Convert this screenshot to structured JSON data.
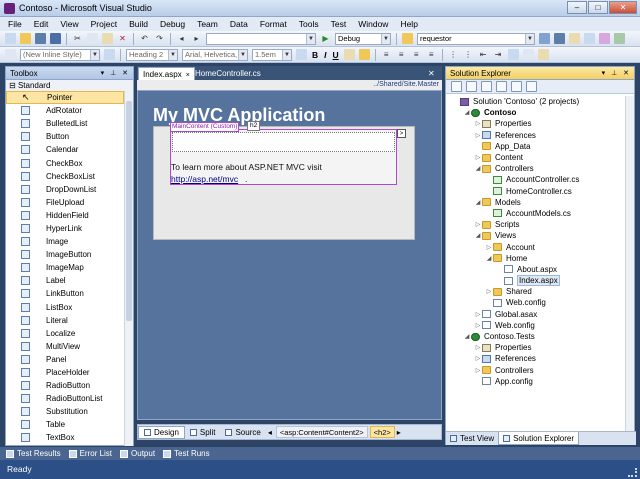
{
  "window": {
    "title": "Contoso - Microsoft Visual Studio",
    "minimize": "–",
    "maximize": "□",
    "close": "✕"
  },
  "menu": [
    "File",
    "Edit",
    "View",
    "Project",
    "Build",
    "Debug",
    "Team",
    "Data",
    "Format",
    "Tools",
    "Test",
    "Window",
    "Help"
  ],
  "toolbar1": {
    "config": "Debug",
    "find_value": "requestor"
  },
  "toolbar2": {
    "style": "(New Inline Style)",
    "block_format": "Heading 2",
    "font": "Arial, Helvetica, s",
    "size": "1.5em",
    "bold": "B",
    "italic": "I",
    "underline": "U"
  },
  "toolbox": {
    "title": "Toolbox",
    "group": "Standard",
    "items": [
      "Pointer",
      "AdRotator",
      "BulletedList",
      "Button",
      "Calendar",
      "CheckBox",
      "CheckBoxList",
      "DropDownList",
      "FileUpload",
      "HiddenField",
      "HyperLink",
      "Image",
      "ImageButton",
      "ImageMap",
      "Label",
      "LinkButton",
      "ListBox",
      "Literal",
      "Localize",
      "MultiView",
      "Panel",
      "PlaceHolder",
      "RadioButton",
      "RadioButtonList",
      "Substitution",
      "Table",
      "TextBox"
    ]
  },
  "editor": {
    "tabs": [
      {
        "label": "Index.aspx",
        "close": "×"
      },
      {
        "label": "HomeController.cs",
        "close": ""
      }
    ],
    "master_path": "../Shared/Site.Master",
    "app_title": "My MVC Application",
    "content_label": "MainContent (Custom)",
    "h2_badge": "h2",
    "smart_tag": ">",
    "body_text": "To learn more about ASP.NET MVC visit",
    "link_text": "http://asp.net/mvc",
    "link_suffix": ".",
    "views": [
      "Design",
      "Split",
      "Source"
    ],
    "breadcrumbs": [
      "<asp:Content#Content2>",
      "<h2>"
    ]
  },
  "solution_explorer": {
    "title": "Solution Explorer",
    "tree": [
      {
        "label": "Solution 'Contoso' (2 projects)",
        "level": 0,
        "icon": "sol",
        "twisty": ""
      },
      {
        "label": "Contoso",
        "level": 1,
        "icon": "proj",
        "twisty": "◢",
        "bold": true
      },
      {
        "label": "Properties",
        "level": 2,
        "icon": "prop",
        "twisty": "▷"
      },
      {
        "label": "References",
        "level": 2,
        "icon": "ref",
        "twisty": "▷"
      },
      {
        "label": "App_Data",
        "level": 2,
        "icon": "folder",
        "twisty": ""
      },
      {
        "label": "Content",
        "level": 2,
        "icon": "folder",
        "twisty": "▷"
      },
      {
        "label": "Controllers",
        "level": 2,
        "icon": "folder",
        "twisty": "◢"
      },
      {
        "label": "AccountController.cs",
        "level": 3,
        "icon": "cs",
        "twisty": ""
      },
      {
        "label": "HomeController.cs",
        "level": 3,
        "icon": "cs",
        "twisty": ""
      },
      {
        "label": "Models",
        "level": 2,
        "icon": "folder",
        "twisty": "◢"
      },
      {
        "label": "AccountModels.cs",
        "level": 3,
        "icon": "cs",
        "twisty": ""
      },
      {
        "label": "Scripts",
        "level": 2,
        "icon": "folder",
        "twisty": "▷"
      },
      {
        "label": "Views",
        "level": 2,
        "icon": "folder",
        "twisty": "◢"
      },
      {
        "label": "Account",
        "level": 3,
        "icon": "folder",
        "twisty": "▷"
      },
      {
        "label": "Home",
        "level": 3,
        "icon": "folder",
        "twisty": "◢"
      },
      {
        "label": "About.aspx",
        "level": 4,
        "icon": "file",
        "twisty": ""
      },
      {
        "label": "Index.aspx",
        "level": 4,
        "icon": "file",
        "twisty": "",
        "selected": true
      },
      {
        "label": "Shared",
        "level": 3,
        "icon": "folder",
        "twisty": "▷"
      },
      {
        "label": "Web.config",
        "level": 3,
        "icon": "file",
        "twisty": ""
      },
      {
        "label": "Global.asax",
        "level": 2,
        "icon": "file",
        "twisty": "▷"
      },
      {
        "label": "Web.config",
        "level": 2,
        "icon": "file",
        "twisty": "▷"
      },
      {
        "label": "Contoso.Tests",
        "level": 1,
        "icon": "proj",
        "twisty": "◢"
      },
      {
        "label": "Properties",
        "level": 2,
        "icon": "prop",
        "twisty": "▷"
      },
      {
        "label": "References",
        "level": 2,
        "icon": "ref",
        "twisty": "▷"
      },
      {
        "label": "Controllers",
        "level": 2,
        "icon": "folder",
        "twisty": "▷"
      },
      {
        "label": "App.config",
        "level": 2,
        "icon": "file",
        "twisty": ""
      }
    ],
    "tabs": [
      "Test View",
      "Solution Explorer"
    ]
  },
  "bottom_tabs": [
    "Test Results",
    "Error List",
    "Output",
    "Test Runs"
  ],
  "status": "Ready"
}
